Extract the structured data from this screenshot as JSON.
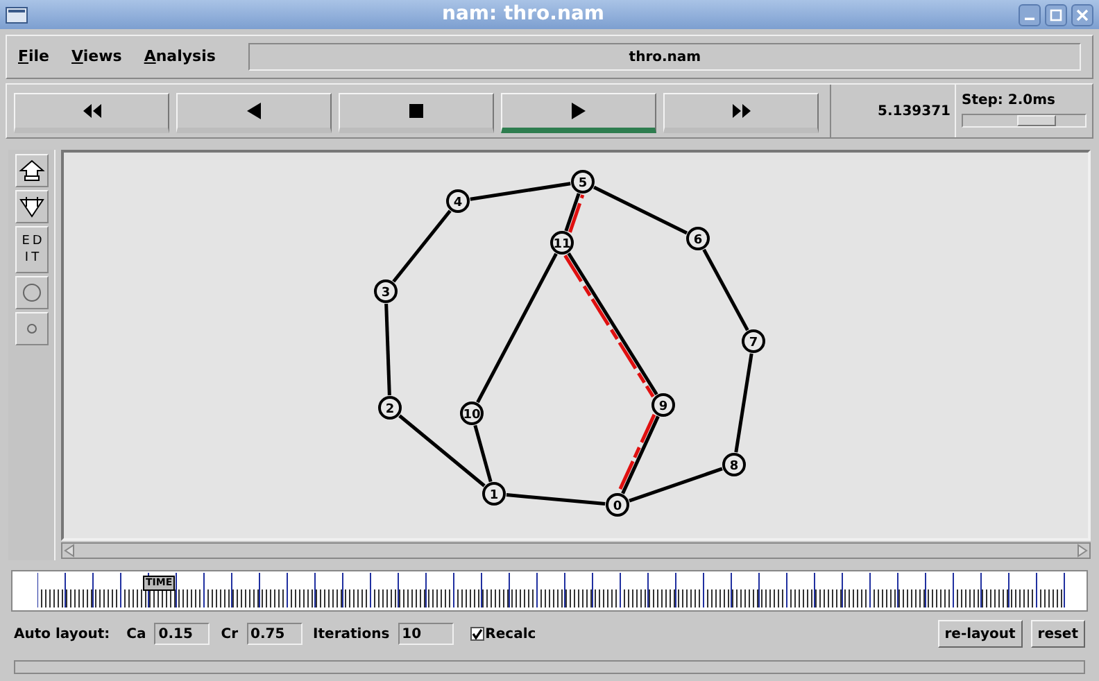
{
  "window": {
    "title": "nam: thro.nam"
  },
  "menu": [
    {
      "label": "File"
    },
    {
      "label": "Views"
    },
    {
      "label": "Analysis"
    }
  ],
  "file_field": "thro.nam",
  "playback": {
    "buttons": [
      {
        "kind": "fast-rewind",
        "selected": false
      },
      {
        "kind": "rewind",
        "selected": false
      },
      {
        "kind": "stop",
        "selected": false
      },
      {
        "kind": "play",
        "selected": true
      },
      {
        "kind": "fast-forward",
        "selected": false
      }
    ],
    "time": "5.139371",
    "step": "Step: 2.0ms",
    "step_slider": {
      "level": 0.6
    }
  },
  "tools": [
    {
      "kind": "zoom-in"
    },
    {
      "kind": "zoom-out"
    },
    {
      "kind": "edit",
      "label": "EDIT"
    },
    {
      "kind": "big-node"
    },
    {
      "kind": "small-node"
    }
  ],
  "network": {
    "nodes": [
      {
        "label": "0"
      },
      {
        "label": "1"
      },
      {
        "label": "2"
      },
      {
        "label": "3"
      },
      {
        "label": "4"
      },
      {
        "label": "5"
      },
      {
        "label": "6"
      },
      {
        "label": "7"
      },
      {
        "label": "8"
      },
      {
        "label": "9"
      },
      {
        "label": "10"
      },
      {
        "label": "11"
      }
    ],
    "links": [
      {
        "packets": false
      },
      {
        "packets": false
      },
      {
        "packets": false
      },
      {
        "packets": false
      },
      {
        "packets": false
      },
      {
        "packets": false
      },
      {
        "packets": false
      },
      {
        "packets": false
      },
      {
        "packets": false
      },
      {
        "packets": false
      },
      {
        "packets": false
      },
      {
        "packets": true
      },
      {
        "packets": true
      },
      {
        "packets": true
      }
    ]
  },
  "timeline": {
    "marker": "TIME",
    "level": 0.12
  },
  "auto_layout": {
    "label": "Auto layout:",
    "fields": [
      {
        "label": "Ca",
        "value": "0.15"
      },
      {
        "label": "Cr",
        "value": "0.75"
      },
      {
        "label": "Iterations",
        "value": "10"
      }
    ],
    "recalc": {
      "label": "Recalc",
      "checked": true
    },
    "buttons": [
      "re-layout",
      "reset"
    ]
  }
}
